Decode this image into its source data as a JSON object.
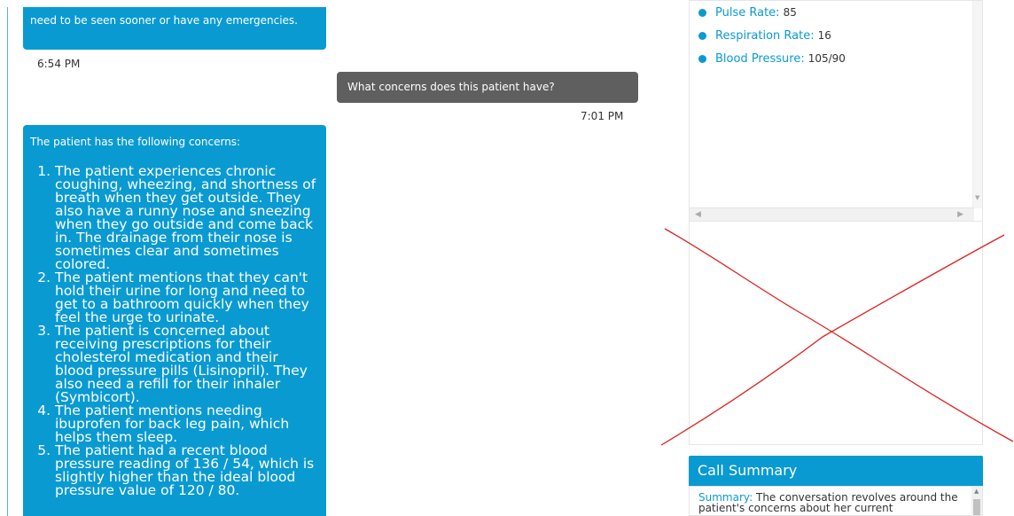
{
  "chat": {
    "messages": [
      {
        "from": "assistant",
        "text": "need to be seen sooner or have any emergencies.",
        "time": "6:54 PM"
      },
      {
        "from": "user",
        "text": "What concerns does this patient have?",
        "time": "7:01 PM"
      },
      {
        "from": "assistant",
        "intro": "The patient has the following concerns:",
        "items": [
          "The patient experiences chronic coughing, wheezing, and shortness of breath when they get outside. They also have a runny nose and sneezing when they go outside and come back in. The drainage from their nose is sometimes clear and sometimes colored.",
          "The patient mentions that they can't hold their urine for long and need to get to a bathroom quickly when they feel the urge to urinate.",
          "The patient is concerned about receiving prescriptions for their cholesterol medication and their blood pressure pills (Lisinopril). They also need a refill for their inhaler (Symbicort).",
          "The patient mentions needing ibuprofen for back leg pain, which helps them sleep.",
          "The patient had a recent blood pressure reading of 136 / 54, which is slightly higher than the ideal blood pressure value of 120 / 80."
        ]
      }
    ]
  },
  "vitals": [
    {
      "label": "Pulse Rate:",
      "value": "85"
    },
    {
      "label": "Respiration Rate:",
      "value": "16"
    },
    {
      "label": "Blood Pressure:",
      "value": "105/90"
    }
  ],
  "call_summary": {
    "title": "Call Summary",
    "label": "Summary:",
    "text": "The conversation revolves around the patient's concerns about her current"
  },
  "colors": {
    "accent": "#0a9ad2",
    "user_bubble": "#5f5f5f",
    "annotation": "#e02020"
  },
  "icons": {
    "scroll_up": "triangle-up-icon",
    "scroll_down": "triangle-down-icon",
    "scroll_left": "triangle-left-icon",
    "scroll_right": "triangle-right-icon"
  }
}
